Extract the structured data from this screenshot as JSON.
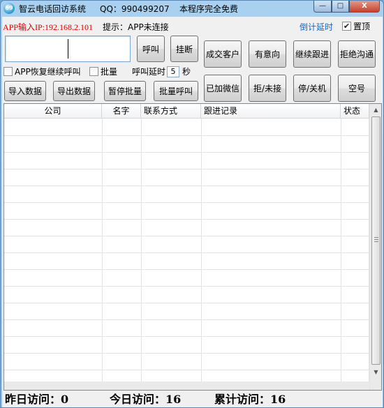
{
  "window": {
    "title": "智云电话回访系统",
    "qq": "QQ：990499207",
    "free_notice": "本程序完全免费",
    "minimize_glyph": "—",
    "maximize_glyph": "□",
    "close_glyph": "X",
    "icon_text": "69"
  },
  "top": {
    "app_ip_label": "APP输入IP:192.168.2.101",
    "hint": "提示：APP未连接",
    "countdown_link": "倒计延时",
    "pin_label": "置顶",
    "pin_checked": true
  },
  "buttons": {
    "call": "呼叫",
    "hangup": "挂断",
    "deal": "成交客户",
    "interested": "有意向",
    "follow": "继续跟进",
    "refuse_talk": "拒绝沟通",
    "wechat": "已加微信",
    "refused": "拒/未接",
    "off": "停/关机",
    "empty": "空号",
    "import": "导入数据",
    "export": "导出数据",
    "pause_batch": "暂停批量",
    "batch_call": "批量呼叫"
  },
  "options": {
    "resume_label": "APP恢复继续呼叫",
    "resume_checked": false,
    "batch_label": "批量",
    "batch_checked": false,
    "delay_label": "呼叫延时",
    "delay_value": "5",
    "delay_unit": "秒"
  },
  "table": {
    "columns": [
      "公司",
      "名字",
      "联系方式",
      "跟进记录",
      "状态"
    ],
    "rows": []
  },
  "status": {
    "yesterday": "昨日访问：0",
    "today": "今日访问：16",
    "total": "累计访问：16"
  }
}
